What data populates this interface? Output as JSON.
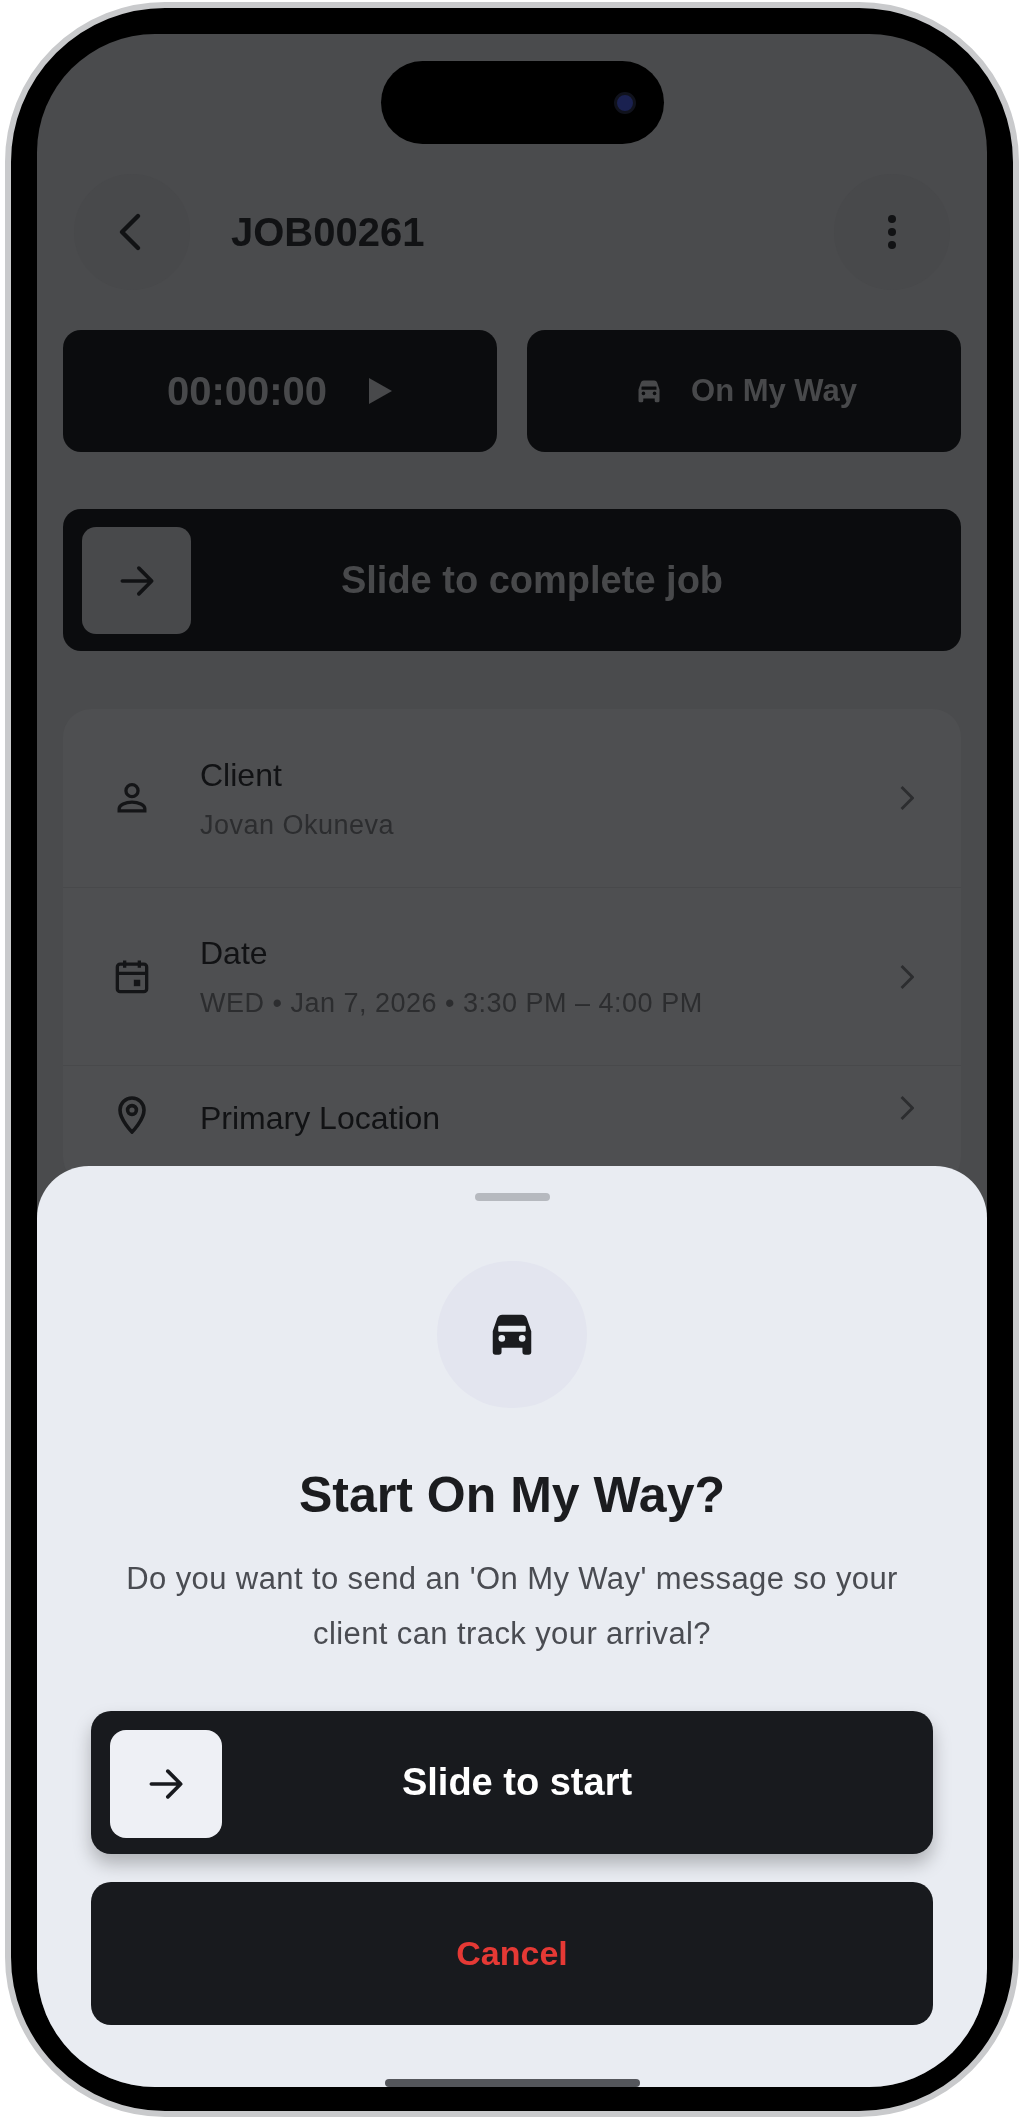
{
  "header": {
    "title": "JOB00261"
  },
  "timer": {
    "time": "00:00:00"
  },
  "on_my_way_button": {
    "label": "On My Way"
  },
  "complete_slider": {
    "label": "Slide to complete job",
    "level": 0
  },
  "details": [
    {
      "kind": "client",
      "label": "Client",
      "value": "Jovan Okuneva"
    },
    {
      "kind": "date",
      "label": "Date",
      "value": "WED • Jan 7, 2026 • 3:30 PM – 4:00 PM"
    },
    {
      "kind": "location",
      "label": "Primary Location"
    }
  ],
  "sheet": {
    "title": "Start On My Way?",
    "message": "Do you want to send an 'On My Way' message so your client can track your arrival?",
    "slider": {
      "label": "Slide to start",
      "level": 0
    },
    "cancel": "Cancel"
  }
}
